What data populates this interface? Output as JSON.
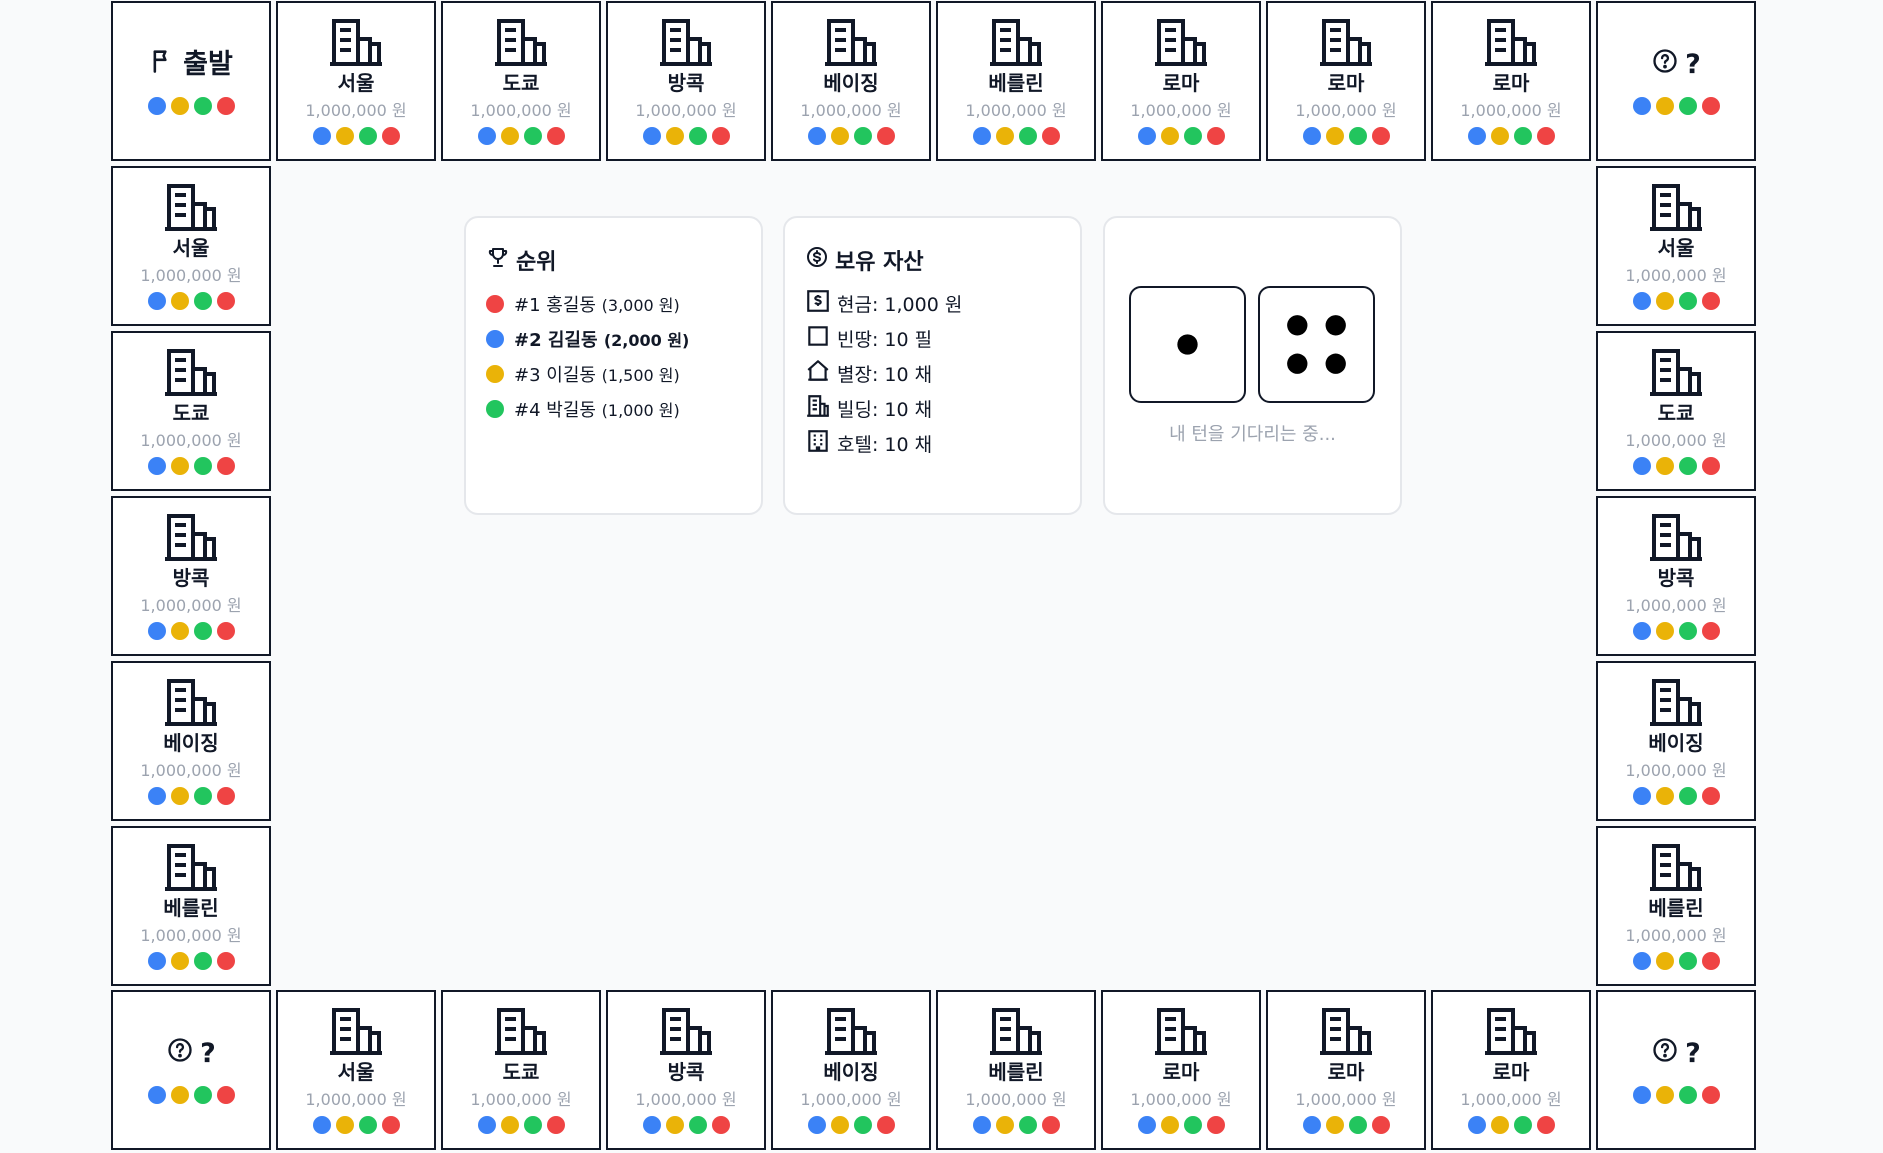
{
  "colors": {
    "red": "#ef4444",
    "blue": "#3b82f6",
    "yellow": "#eab308",
    "green": "#22c55e",
    "border": "#111827",
    "muted": "#9ca3af"
  },
  "player_dot_colors": [
    "#3b82f6",
    "#eab308",
    "#22c55e",
    "#ef4444"
  ],
  "corners": {
    "top_left": {
      "icon": "flag-icon",
      "label": "출발"
    },
    "top_right": {
      "icon": "question-icon",
      "label": "?"
    },
    "bottom_left": {
      "icon": "question-icon",
      "label": "?"
    },
    "bottom_right": {
      "icon": "question-icon",
      "label": "?"
    }
  },
  "top_row": [
    {
      "name": "서울",
      "price": "1,000,000 원"
    },
    {
      "name": "도쿄",
      "price": "1,000,000 원"
    },
    {
      "name": "방콕",
      "price": "1,000,000 원"
    },
    {
      "name": "베이징",
      "price": "1,000,000 원"
    },
    {
      "name": "베를린",
      "price": "1,000,000 원"
    },
    {
      "name": "로마",
      "price": "1,000,000 원"
    },
    {
      "name": "로마",
      "price": "1,000,000 원"
    },
    {
      "name": "로마",
      "price": "1,000,000 원"
    }
  ],
  "left_col": [
    {
      "name": "서울",
      "price": "1,000,000 원"
    },
    {
      "name": "도쿄",
      "price": "1,000,000 원"
    },
    {
      "name": "방콕",
      "price": "1,000,000 원"
    },
    {
      "name": "베이징",
      "price": "1,000,000 원"
    },
    {
      "name": "베를린",
      "price": "1,000,000 원"
    }
  ],
  "right_col": [
    {
      "name": "서울",
      "price": "1,000,000 원"
    },
    {
      "name": "도쿄",
      "price": "1,000,000 원"
    },
    {
      "name": "방콕",
      "price": "1,000,000 원"
    },
    {
      "name": "베이징",
      "price": "1,000,000 원"
    },
    {
      "name": "베를린",
      "price": "1,000,000 원"
    }
  ],
  "bottom_row": [
    {
      "name": "서울",
      "price": "1,000,000 원"
    },
    {
      "name": "도쿄",
      "price": "1,000,000 원"
    },
    {
      "name": "방콕",
      "price": "1,000,000 원"
    },
    {
      "name": "베이징",
      "price": "1,000,000 원"
    },
    {
      "name": "베를린",
      "price": "1,000,000 원"
    },
    {
      "name": "로마",
      "price": "1,000,000 원"
    },
    {
      "name": "로마",
      "price": "1,000,000 원"
    },
    {
      "name": "로마",
      "price": "1,000,000 원"
    }
  ],
  "ranking": {
    "title": "순위",
    "icon": "trophy-icon",
    "items": [
      {
        "rank": "#1",
        "name": "홍길동",
        "amount": "(3,000 원)",
        "color": "#ef4444",
        "current_player": false
      },
      {
        "rank": "#2",
        "name": "김길동",
        "amount": "(2,000 원)",
        "color": "#3b82f6",
        "current_player": true
      },
      {
        "rank": "#3",
        "name": "이길동",
        "amount": "(1,500 원)",
        "color": "#eab308",
        "current_player": false
      },
      {
        "rank": "#4",
        "name": "박길동",
        "amount": "(1,000 원)",
        "color": "#22c55e",
        "current_player": false
      }
    ]
  },
  "assets": {
    "title": "보유 자산",
    "icon": "dollar-circle-icon",
    "items": [
      {
        "icon": "banknote-icon",
        "label": "현금: 1,000 원"
      },
      {
        "icon": "square-icon",
        "label": "빈땅: 10 필"
      },
      {
        "icon": "house-icon",
        "label": "별장: 10 채"
      },
      {
        "icon": "building-icon",
        "label": "빌딩: 10 채"
      },
      {
        "icon": "hotel-icon",
        "label": "호텔: 10 채"
      }
    ]
  },
  "dice": {
    "values": [
      1,
      4
    ],
    "status_text": "내 턴을 기다리는 중..."
  }
}
